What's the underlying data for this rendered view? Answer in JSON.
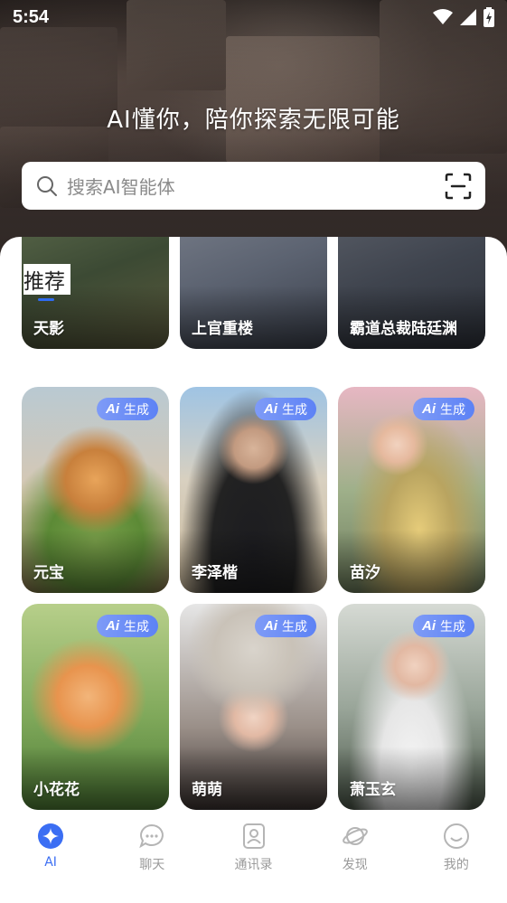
{
  "status_bar": {
    "time": "5:54"
  },
  "hero": {
    "title": "AI懂你，陪你探索无限可能"
  },
  "search": {
    "placeholder": "搜索AI智能体"
  },
  "section": {
    "title": "推荐"
  },
  "badge": {
    "ai": "Ai",
    "text": "生成"
  },
  "cards": [
    {
      "name": "天影",
      "badge": false
    },
    {
      "name": "上官重楼",
      "badge": false
    },
    {
      "name": "霸道总裁陆廷渊",
      "badge": false
    },
    {
      "name": "元宝",
      "badge": true
    },
    {
      "name": "李泽楷",
      "badge": true
    },
    {
      "name": "苗汐",
      "badge": true
    },
    {
      "name": "小花花",
      "badge": true
    },
    {
      "name": "萌萌",
      "badge": true
    },
    {
      "name": "萧玉玄",
      "badge": true
    }
  ],
  "tabs": [
    {
      "label": "AI",
      "icon": "ai-star-icon",
      "active": true
    },
    {
      "label": "聊天",
      "icon": "chat-icon",
      "active": false
    },
    {
      "label": "通讯录",
      "icon": "contacts-icon",
      "active": false
    },
    {
      "label": "发现",
      "icon": "discover-planet-icon",
      "active": false
    },
    {
      "label": "我的",
      "icon": "profile-smile-icon",
      "active": false
    }
  ],
  "colors": {
    "accent": "#3b6ef3",
    "badge_start": "#7e9bf7",
    "badge_end": "#5d82f5"
  }
}
